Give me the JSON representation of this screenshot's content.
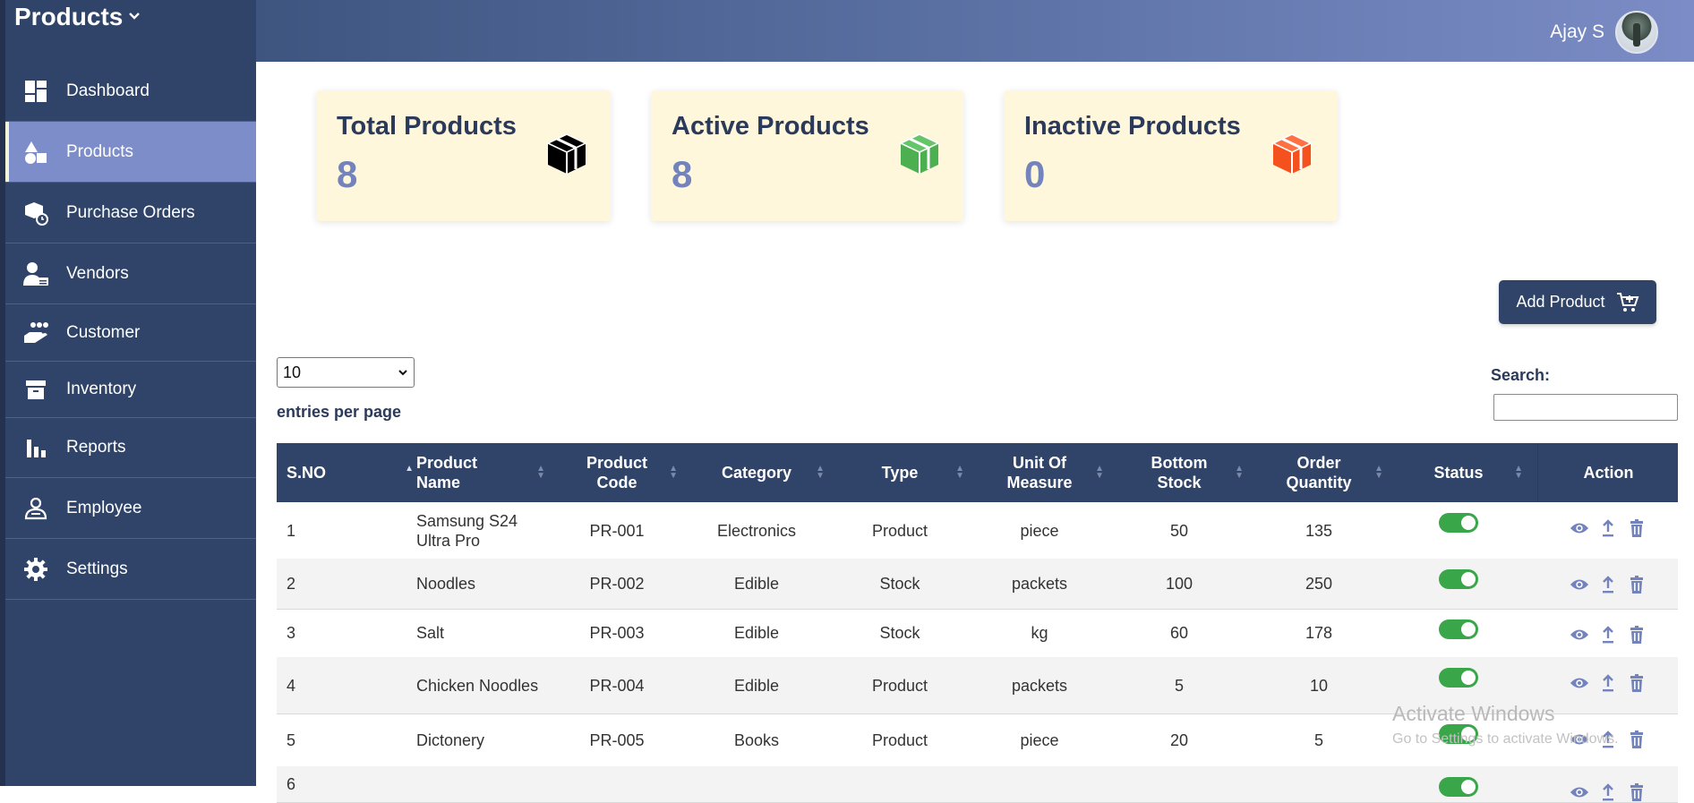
{
  "sidebar": {
    "brand": "Products",
    "items": [
      {
        "label": "Dashboard",
        "icon": "dashboard-icon",
        "active": false
      },
      {
        "label": "Products",
        "icon": "shapes-icon",
        "active": true
      },
      {
        "label": "Purchase Orders",
        "icon": "box-clock-icon",
        "active": false
      },
      {
        "label": "Vendors",
        "icon": "user-card-icon",
        "active": false
      },
      {
        "label": "Customer",
        "icon": "hand-people-icon",
        "active": false
      },
      {
        "label": "Inventory",
        "icon": "archive-icon",
        "active": false
      },
      {
        "label": "Reports",
        "icon": "bar-chart-icon",
        "active": false
      },
      {
        "label": "Employee",
        "icon": "person-badge-icon",
        "active": false
      },
      {
        "label": "Settings",
        "icon": "gear-icon",
        "active": false
      }
    ]
  },
  "header": {
    "user_name": "Ajay S"
  },
  "cards": [
    {
      "title": "Total Products",
      "value": "8",
      "icon": "box-icon",
      "icon_color": "#000000"
    },
    {
      "title": "Active Products",
      "value": "8",
      "icon": "box-icon",
      "icon_color": "#4caf50"
    },
    {
      "title": "Inactive Products",
      "value": "0",
      "icon": "box-icon",
      "icon_color": "#f4511e"
    }
  ],
  "toolbar": {
    "add_label": "Add Product"
  },
  "table_controls": {
    "page_size": "10",
    "entries_label": "entries per page",
    "search_label": "Search:",
    "search_value": ""
  },
  "table": {
    "headers": [
      "S.NO",
      "Product Name",
      "Product Code",
      "Category",
      "Type",
      "Unit Of Measure",
      "Bottom Stock",
      "Order Quantity",
      "Status",
      "Action"
    ],
    "rows": [
      {
        "sno": "1",
        "name": "Samsung S24 Ultra Pro",
        "code": "PR-001",
        "category": "Electronics",
        "type": "Product",
        "uom": "piece",
        "bottom": "50",
        "order": "135",
        "active": true
      },
      {
        "sno": "2",
        "name": "Noodles",
        "code": "PR-002",
        "category": "Edible",
        "type": "Stock",
        "uom": "packets",
        "bottom": "100",
        "order": "250",
        "active": true
      },
      {
        "sno": "3",
        "name": "Salt",
        "code": "PR-003",
        "category": "Edible",
        "type": "Stock",
        "uom": "kg",
        "bottom": "60",
        "order": "178",
        "active": true
      },
      {
        "sno": "4",
        "name": "Chicken Noodles",
        "code": "PR-004",
        "category": "Edible",
        "type": "Product",
        "uom": "packets",
        "bottom": "5",
        "order": "10",
        "active": true
      },
      {
        "sno": "5",
        "name": "Dictonery",
        "code": "PR-005",
        "category": "Books",
        "type": "Product",
        "uom": "piece",
        "bottom": "20",
        "order": "5",
        "active": true
      },
      {
        "sno": "6",
        "name": "",
        "code": "",
        "category": "",
        "type": "",
        "uom": "",
        "bottom": "",
        "order": "",
        "active": true
      }
    ]
  },
  "watermark": {
    "line1": "Activate Windows",
    "line2": "Go to Settings to activate Windows."
  },
  "colors": {
    "sidebar": "#2f4468",
    "active_nav": "#7d8dc9",
    "card_bg": "#fff7dc",
    "toggle_on": "#3aa64a",
    "action_icon": "#7384bd"
  }
}
